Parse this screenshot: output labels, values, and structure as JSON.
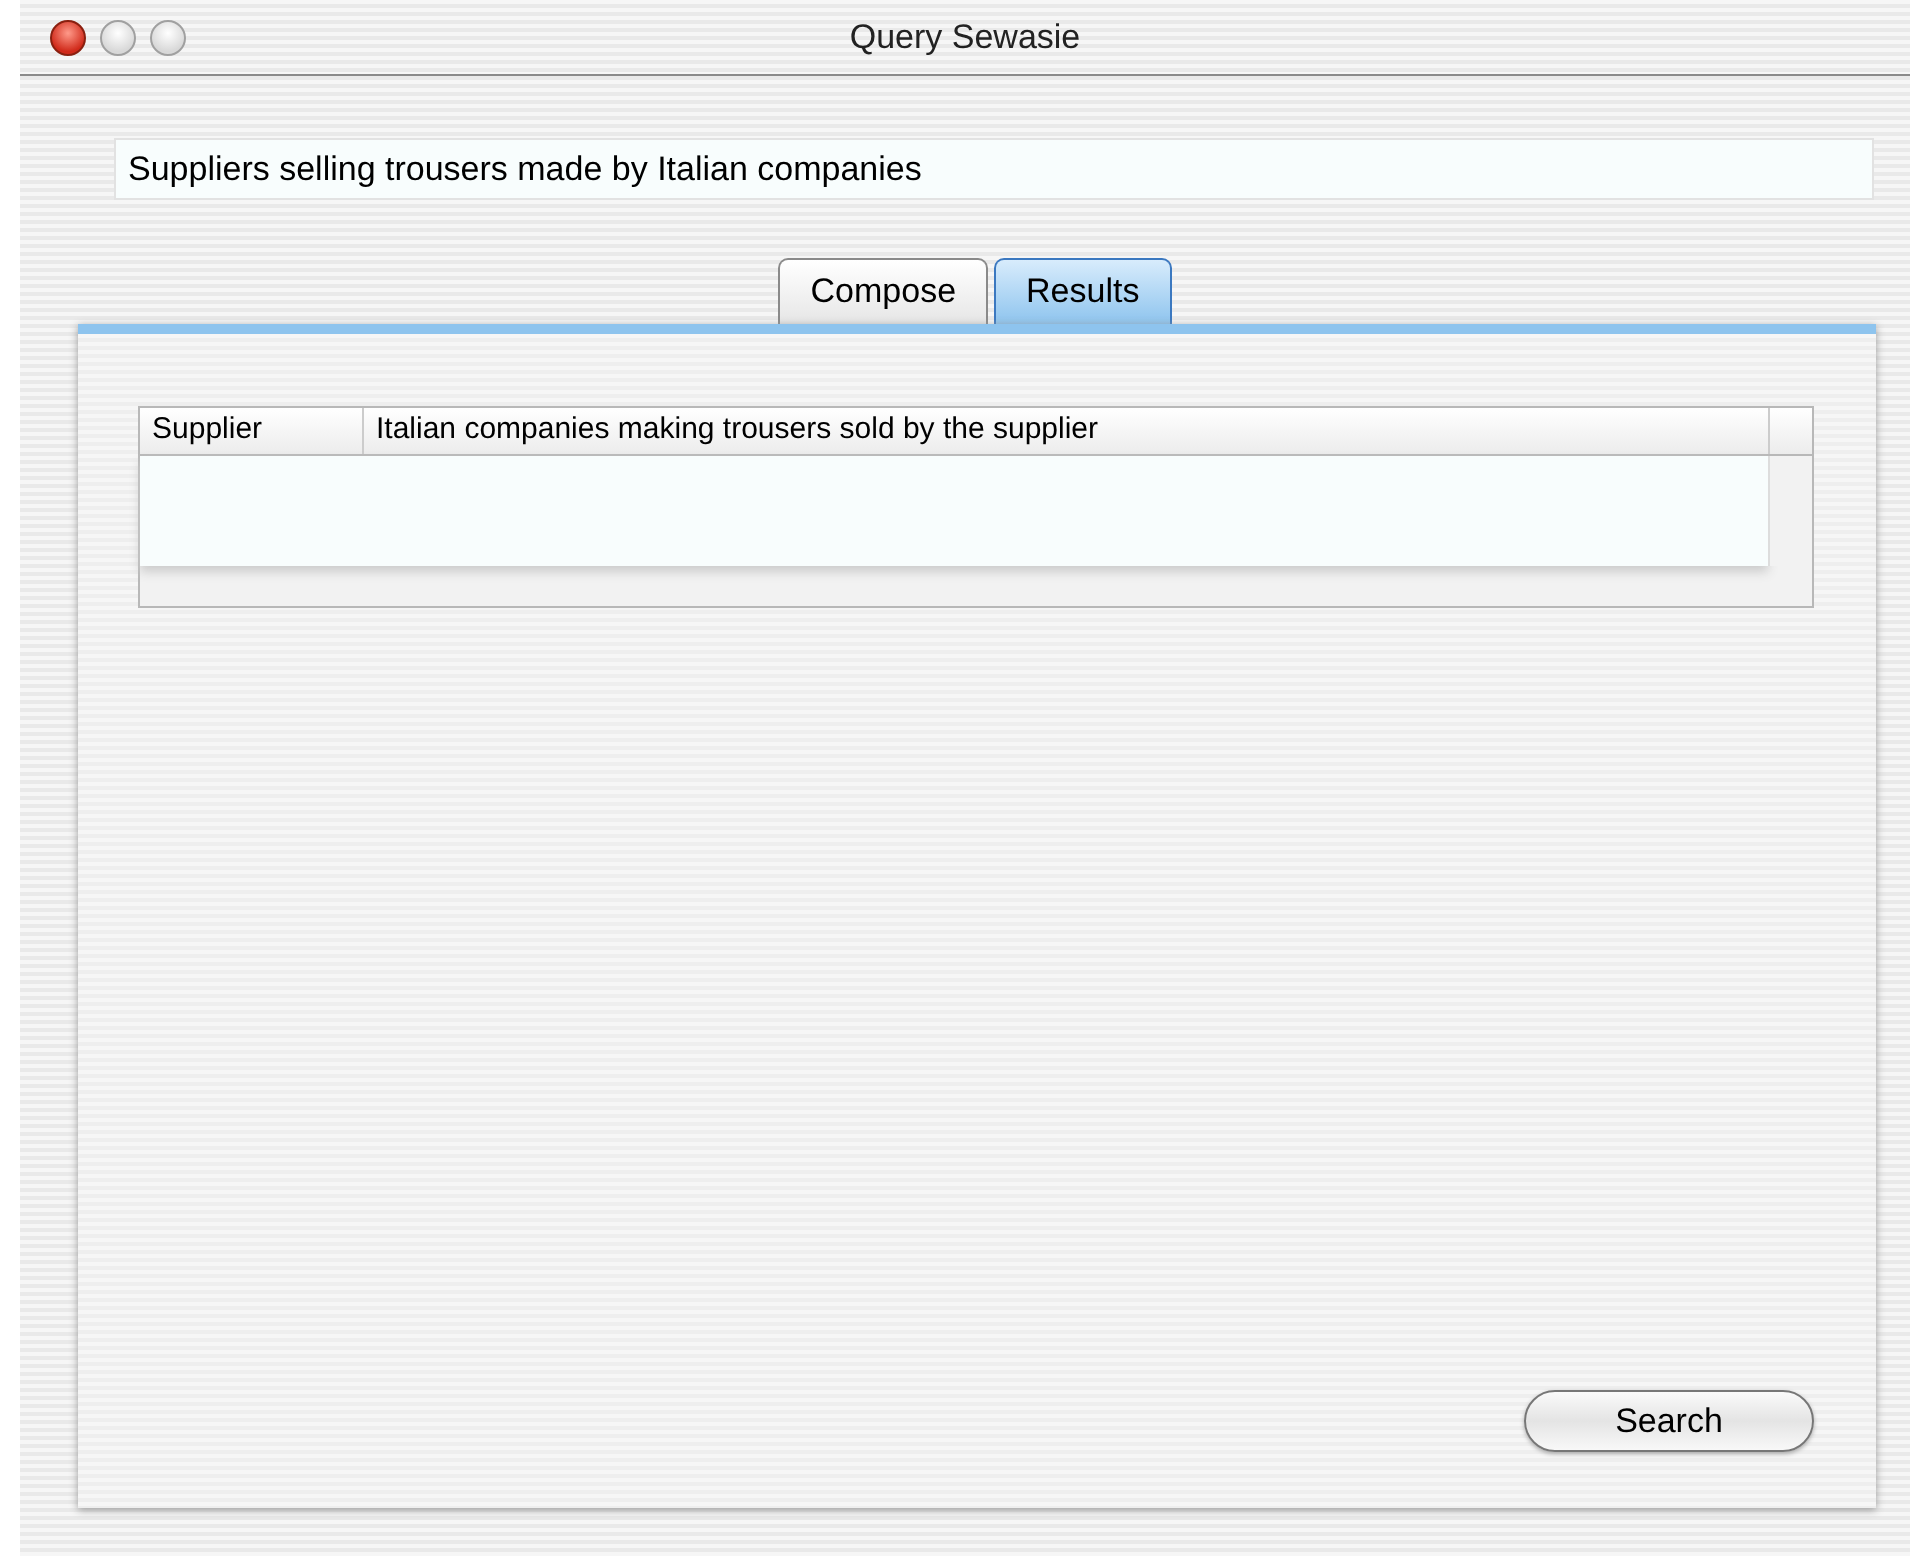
{
  "window": {
    "title": "Query Sewasie"
  },
  "query": {
    "value": "Suppliers selling trousers made by Italian companies"
  },
  "tabs": [
    {
      "label": "Compose",
      "selected": false
    },
    {
      "label": "Results",
      "selected": true
    }
  ],
  "table": {
    "columns": [
      "Supplier",
      "Italian companies making trousers sold by the supplier"
    ]
  },
  "buttons": [
    "Search"
  ]
}
